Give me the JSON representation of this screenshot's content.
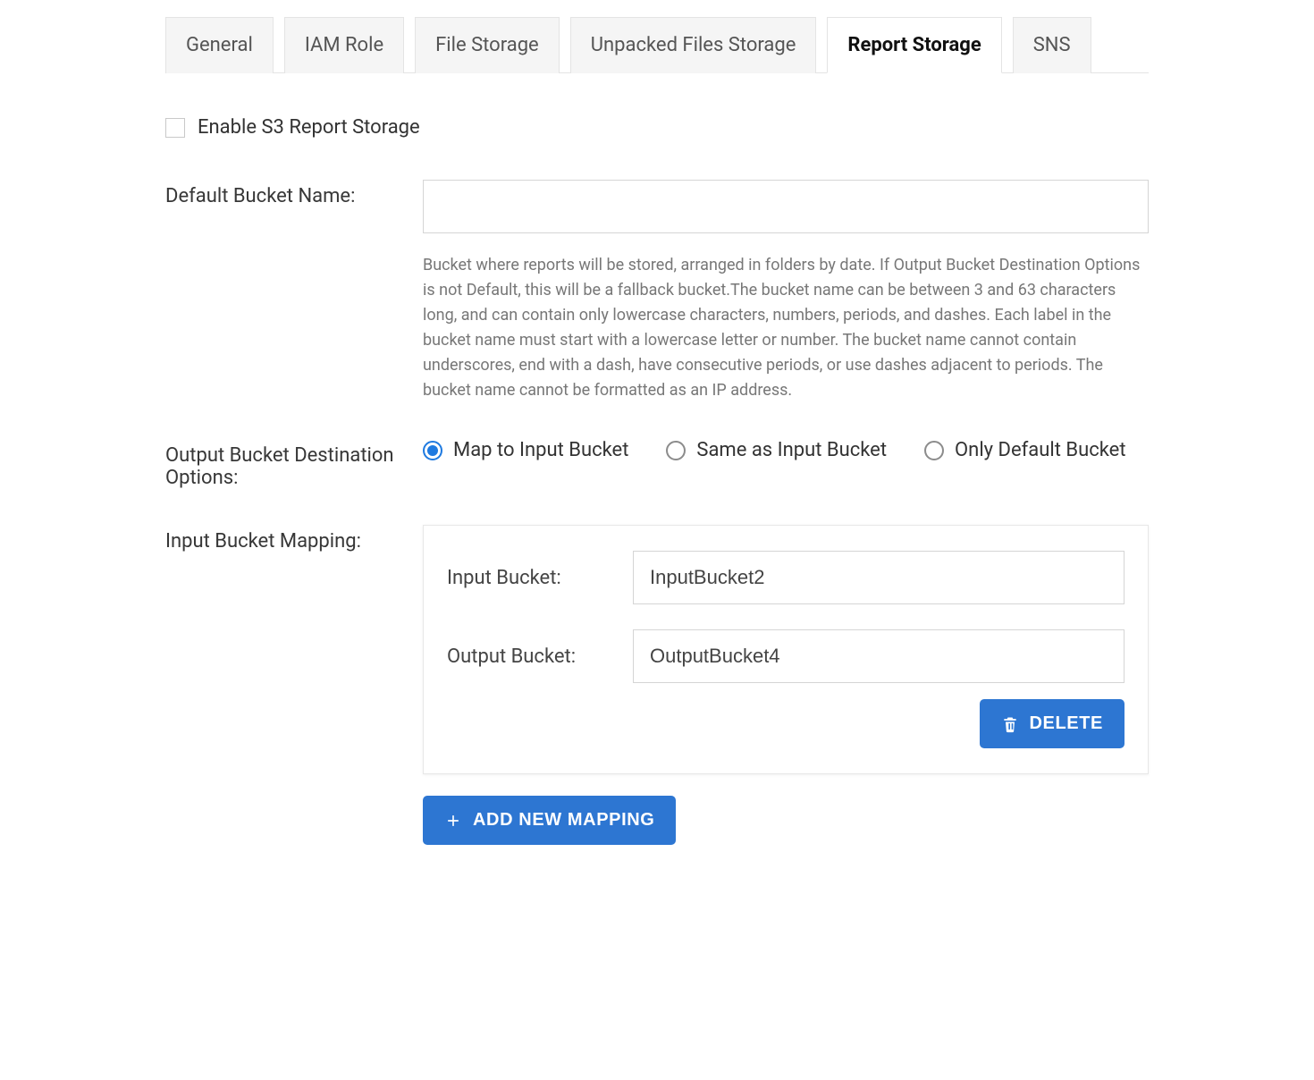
{
  "tabs": [
    {
      "label": "General",
      "active": false
    },
    {
      "label": "IAM Role",
      "active": false
    },
    {
      "label": "File Storage",
      "active": false
    },
    {
      "label": "Unpacked Files Storage",
      "active": false
    },
    {
      "label": "Report Storage",
      "active": true
    },
    {
      "label": "SNS",
      "active": false
    }
  ],
  "enable_storage": {
    "label": "Enable S3 Report Storage",
    "checked": false
  },
  "default_bucket": {
    "label": "Default Bucket Name:",
    "value": "",
    "help": "Bucket where reports will be stored, arranged in folders by date. If Output Bucket Destination Options is not Default, this will be a fallback bucket.The bucket name can be between 3 and 63 characters long, and can contain only lowercase characters, numbers, periods, and dashes. Each label in the bucket name must start with a lowercase letter or number. The bucket name cannot contain underscores, end with a dash, have consecutive periods, or use dashes adjacent to periods. The bucket name cannot be formatted as an IP address."
  },
  "dest_options": {
    "label": "Output Bucket Destination Options:",
    "options": [
      {
        "label": "Map to Input Bucket",
        "checked": true
      },
      {
        "label": "Same as Input Bucket",
        "checked": false
      },
      {
        "label": "Only Default Bucket",
        "checked": false
      }
    ]
  },
  "mapping": {
    "label": "Input Bucket Mapping:",
    "input_bucket": {
      "label": "Input Bucket:",
      "value": "InputBucket2"
    },
    "output_bucket": {
      "label": "Output Bucket:",
      "value": "OutputBucket4"
    },
    "delete_label": "DELETE"
  },
  "add_mapping_label": "ADD NEW MAPPING"
}
